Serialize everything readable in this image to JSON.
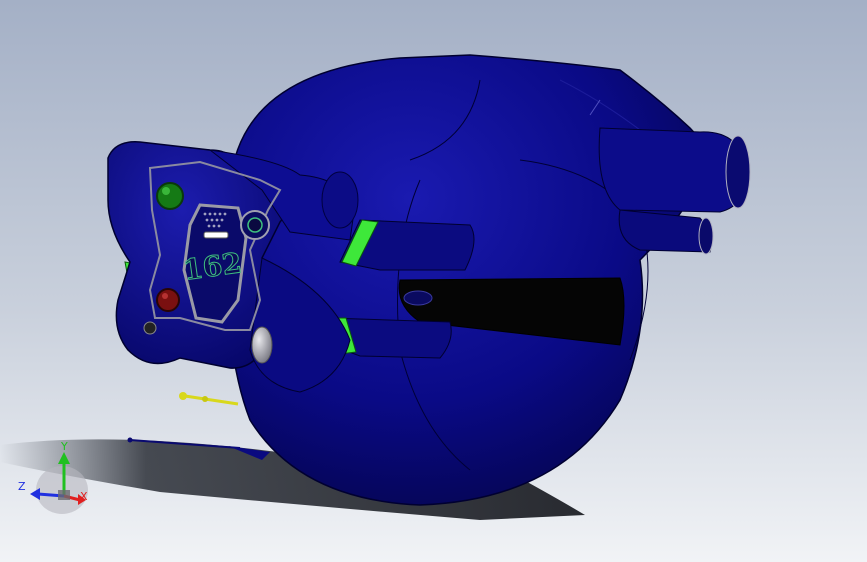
{
  "viewport": {
    "hull_number": "162",
    "triad": {
      "x_label": "X",
      "y_label": "Y",
      "z_label": "Z"
    }
  },
  "colors": {
    "hull_blue": "#0a0a7a",
    "hull_dark": "#05054a",
    "accent_green": "#3ee83a",
    "accent_yellow": "#d8d81c",
    "plate_gray": "#9a9aa6",
    "axis_x": "#e02020",
    "axis_y": "#20c020",
    "axis_z": "#2030e0"
  }
}
